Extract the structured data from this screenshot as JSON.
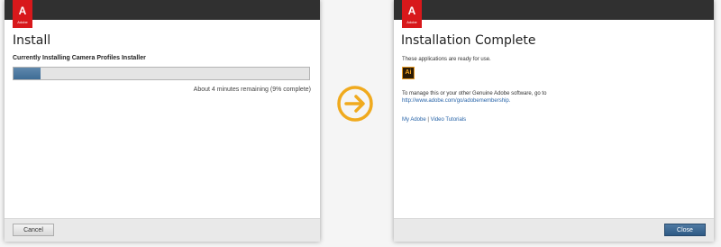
{
  "colors": {
    "accent_arrow": "#f0aa1e",
    "adobe_red": "#d8181b",
    "titlebar": "#303030",
    "link": "#2864a8",
    "progress": "#3e6c95"
  },
  "install_window": {
    "logo_text": "Adobe",
    "title": "Install",
    "status": "Currently Installing Camera Profiles Installer",
    "progress_fraction": 0.09,
    "remaining_text": "About 4 minutes remaining (9% complete)",
    "cancel_label": "Cancel"
  },
  "transition": {
    "icon": "arrow-right-circle-icon"
  },
  "complete_window": {
    "logo_text": "Adobe",
    "title": "Installation Complete",
    "ready_text": "These applications are ready for use.",
    "app_icon_label": "Ai",
    "manage_text": "To manage this or your other Genuine Adobe software, go to",
    "manage_url": "http://www.adobe.com/go/adobemembership.",
    "link_my_adobe": "My Adobe",
    "link_separator": "|",
    "link_video_tutorials": "Video Tutorials",
    "close_label": "Close"
  }
}
